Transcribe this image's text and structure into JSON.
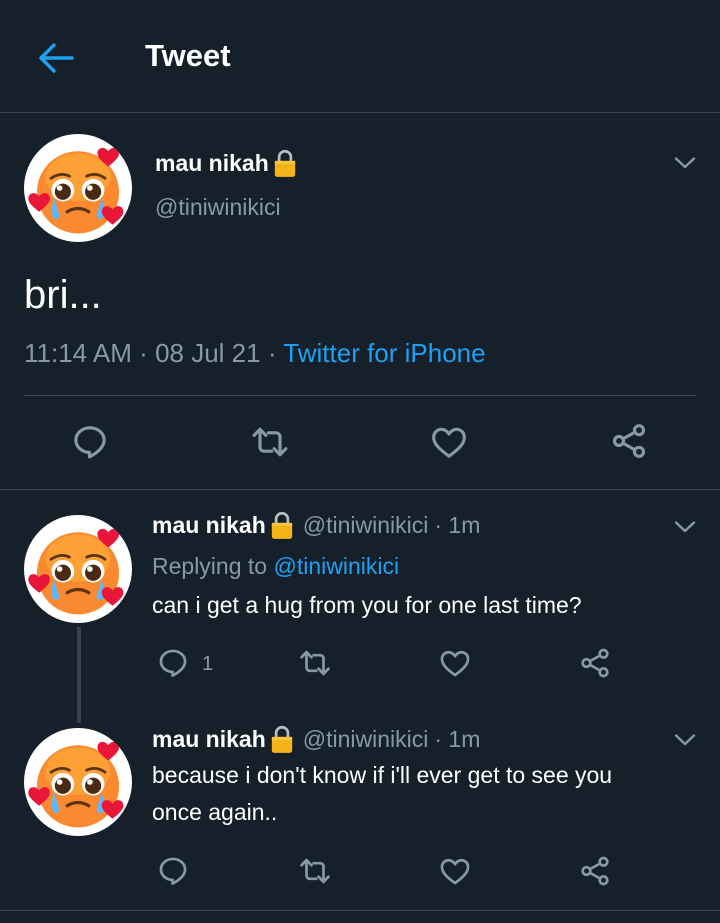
{
  "header": {
    "title": "Tweet"
  },
  "main_tweet": {
    "name": "mau nikah",
    "handle": "@tiniwinikici",
    "text": "bri...",
    "time": "11:14 AM",
    "date": "08 Jul 21",
    "sep": "·",
    "source": "Twitter for iPhone"
  },
  "replies": [
    {
      "name": "mau nikah",
      "handle": "@tiniwinikici",
      "age": "· 1m",
      "replying_prefix": "Replying to",
      "replying_handle": "@tiniwinikici",
      "text": "can i get a hug from you for one last time?",
      "reply_count": "1"
    },
    {
      "name": "mau nikah",
      "handle": "@tiniwinikici",
      "age": "· 1m",
      "text_line1": "because i don't know if i'll ever get to see you",
      "text_line2": "once again.."
    }
  ],
  "colors": {
    "background": "#15202b",
    "accent": "#1da1f2",
    "muted": "#8899a6",
    "divider": "#38444d"
  },
  "icons": [
    "back-arrow-icon",
    "lock-icon",
    "chevron-down-icon",
    "reply-icon",
    "retweet-icon",
    "like-icon",
    "share-icon",
    "pleading-face-emoji"
  ]
}
